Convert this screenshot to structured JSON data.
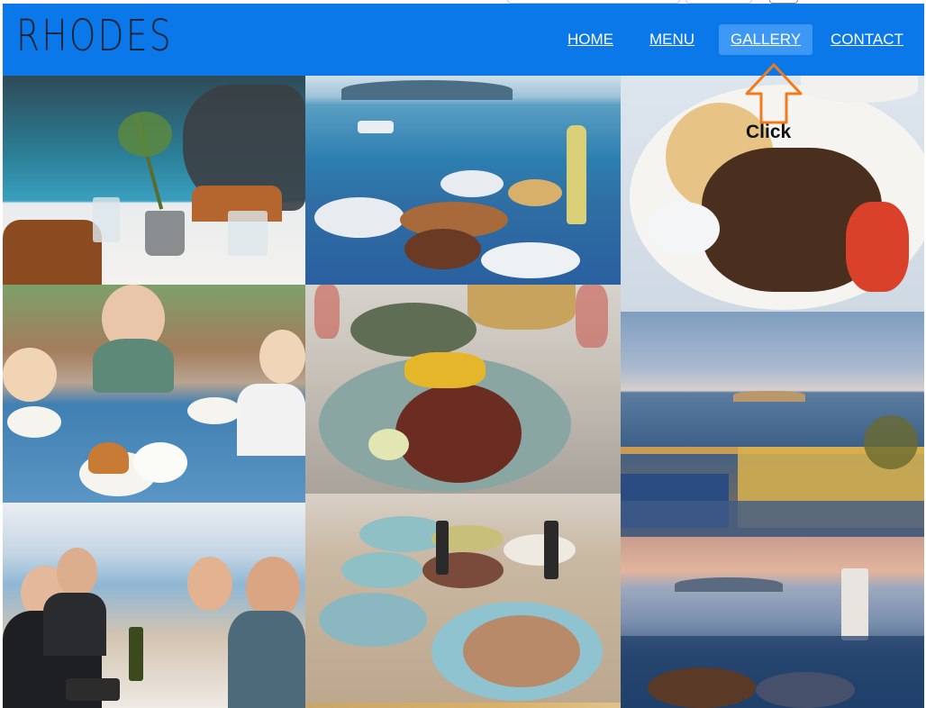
{
  "header": {
    "brand": "RHODES",
    "nav": [
      {
        "label": "HOME",
        "active": false
      },
      {
        "label": "MENU",
        "active": false
      },
      {
        "label": "GALLERY",
        "active": true
      },
      {
        "label": "CONTACT",
        "active": false
      }
    ]
  },
  "annotation": {
    "label": "Click",
    "icon": "arrow-up-icon",
    "color": "#f27a1a"
  },
  "gallery": {
    "photos": [
      "seaside-table-olive-pot-photo",
      "sea-view-dinner-table-photo",
      "souvlaki-plate-photo",
      "family-dinner-photo",
      "octopus-salad-photo",
      "sunset-terrace-photo",
      "friends-toast-photo",
      "mezze-table-photo",
      "harbour-sunset-dinner-photo",
      "partial-photo-bottom"
    ]
  },
  "colors": {
    "header": "#0a78e8",
    "active_nav": "#3d98f5",
    "brand_text": "#1c2230"
  }
}
